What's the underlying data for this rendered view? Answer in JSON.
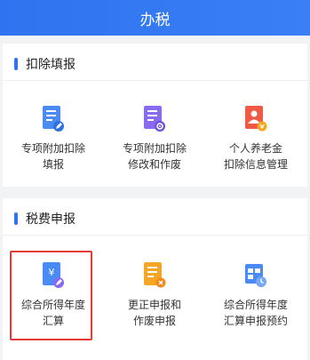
{
  "header": {
    "title": "办税"
  },
  "sections": [
    {
      "title": "扣除填报",
      "items": [
        {
          "label": "专项附加扣除\n填报",
          "icon": "document-edit-icon",
          "color": "#3c7ef0"
        },
        {
          "label": "专项附加扣除\n修改和作废",
          "icon": "document-gear-icon",
          "color": "#7a5ce6"
        },
        {
          "label": "个人养老金\n扣除信息管理",
          "icon": "person-card-icon",
          "color": "#f04a3a"
        }
      ]
    },
    {
      "title": "税费申报",
      "items": [
        {
          "label": "综合所得年度\n汇算",
          "icon": "yuan-document-icon",
          "color": "#3c7ef0",
          "selected": true
        },
        {
          "label": "更正申报和\n作废申报",
          "icon": "document-cancel-icon",
          "color": "#f5a623"
        },
        {
          "label": "综合所得年度\n汇算申报预约",
          "icon": "calendar-clock-icon",
          "color": "#3c7ef0"
        }
      ]
    }
  ],
  "colors": {
    "brand": "#2f73f0",
    "highlight": "#e53935"
  }
}
